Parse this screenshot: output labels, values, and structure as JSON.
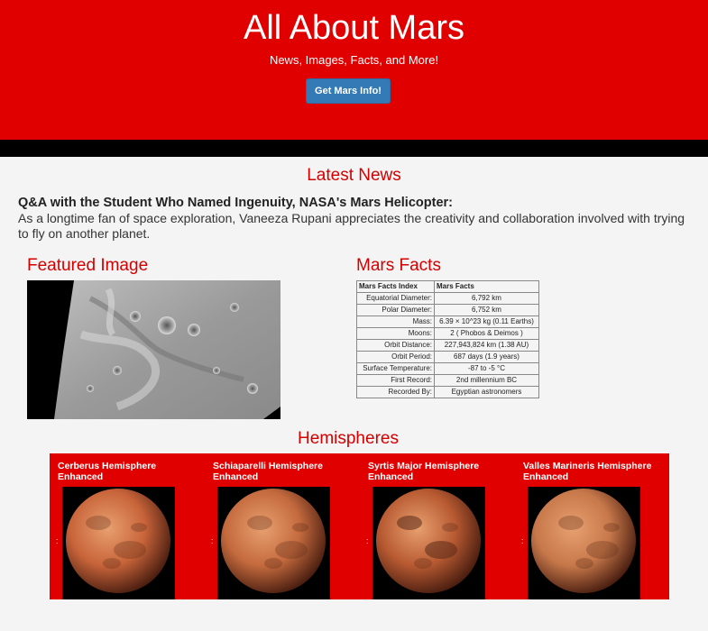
{
  "hero": {
    "title": "All About Mars",
    "subtitle": "News, Images, Facts, and More!",
    "button_label": "Get Mars Info!"
  },
  "news": {
    "heading": "Latest News",
    "title": "Q&A with the Student Who Named Ingenuity, NASA's Mars Helicopter:",
    "body": "As a longtime fan of space exploration, Vaneeza Rupani appreciates the creativity and collaboration involved with trying to fly on another planet."
  },
  "featured": {
    "heading": "Featured Image"
  },
  "facts": {
    "heading": "Mars Facts",
    "col1": "Mars Facts Index",
    "col2": "Mars Facts",
    "rows": [
      {
        "k": "Equatorial Diameter:",
        "v": "6,792 km"
      },
      {
        "k": "Polar Diameter:",
        "v": "6,752 km"
      },
      {
        "k": "Mass:",
        "v": "6.39 × 10^23 kg (0.11 Earths)"
      },
      {
        "k": "Moons:",
        "v": "2 ( Phobos & Deimos )"
      },
      {
        "k": "Orbit Distance:",
        "v": "227,943,824 km (1.38 AU)"
      },
      {
        "k": "Orbit Period:",
        "v": "687 days (1.9 years)"
      },
      {
        "k": "Surface Temperature:",
        "v": "-87 to -5 °C"
      },
      {
        "k": "First Record:",
        "v": "2nd millennium BC"
      },
      {
        "k": "Recorded By:",
        "v": "Egyptian astronomers"
      }
    ]
  },
  "hemispheres": {
    "heading": "Hemispheres",
    "items": [
      {
        "title": "Cerberus Hemisphere Enhanced",
        "sep": ":",
        "color": "#c8643a"
      },
      {
        "title": "Schiaparelli Hemisphere Enhanced",
        "sep": ":",
        "color": "#c46a3e"
      },
      {
        "title": "Syrtis Major Hemisphere Enhanced",
        "sep": ":",
        "color": "#b85a32"
      },
      {
        "title": "Valles Marineris Hemisphere Enhanced",
        "sep": ":",
        "color": "#c7784a"
      }
    ]
  }
}
